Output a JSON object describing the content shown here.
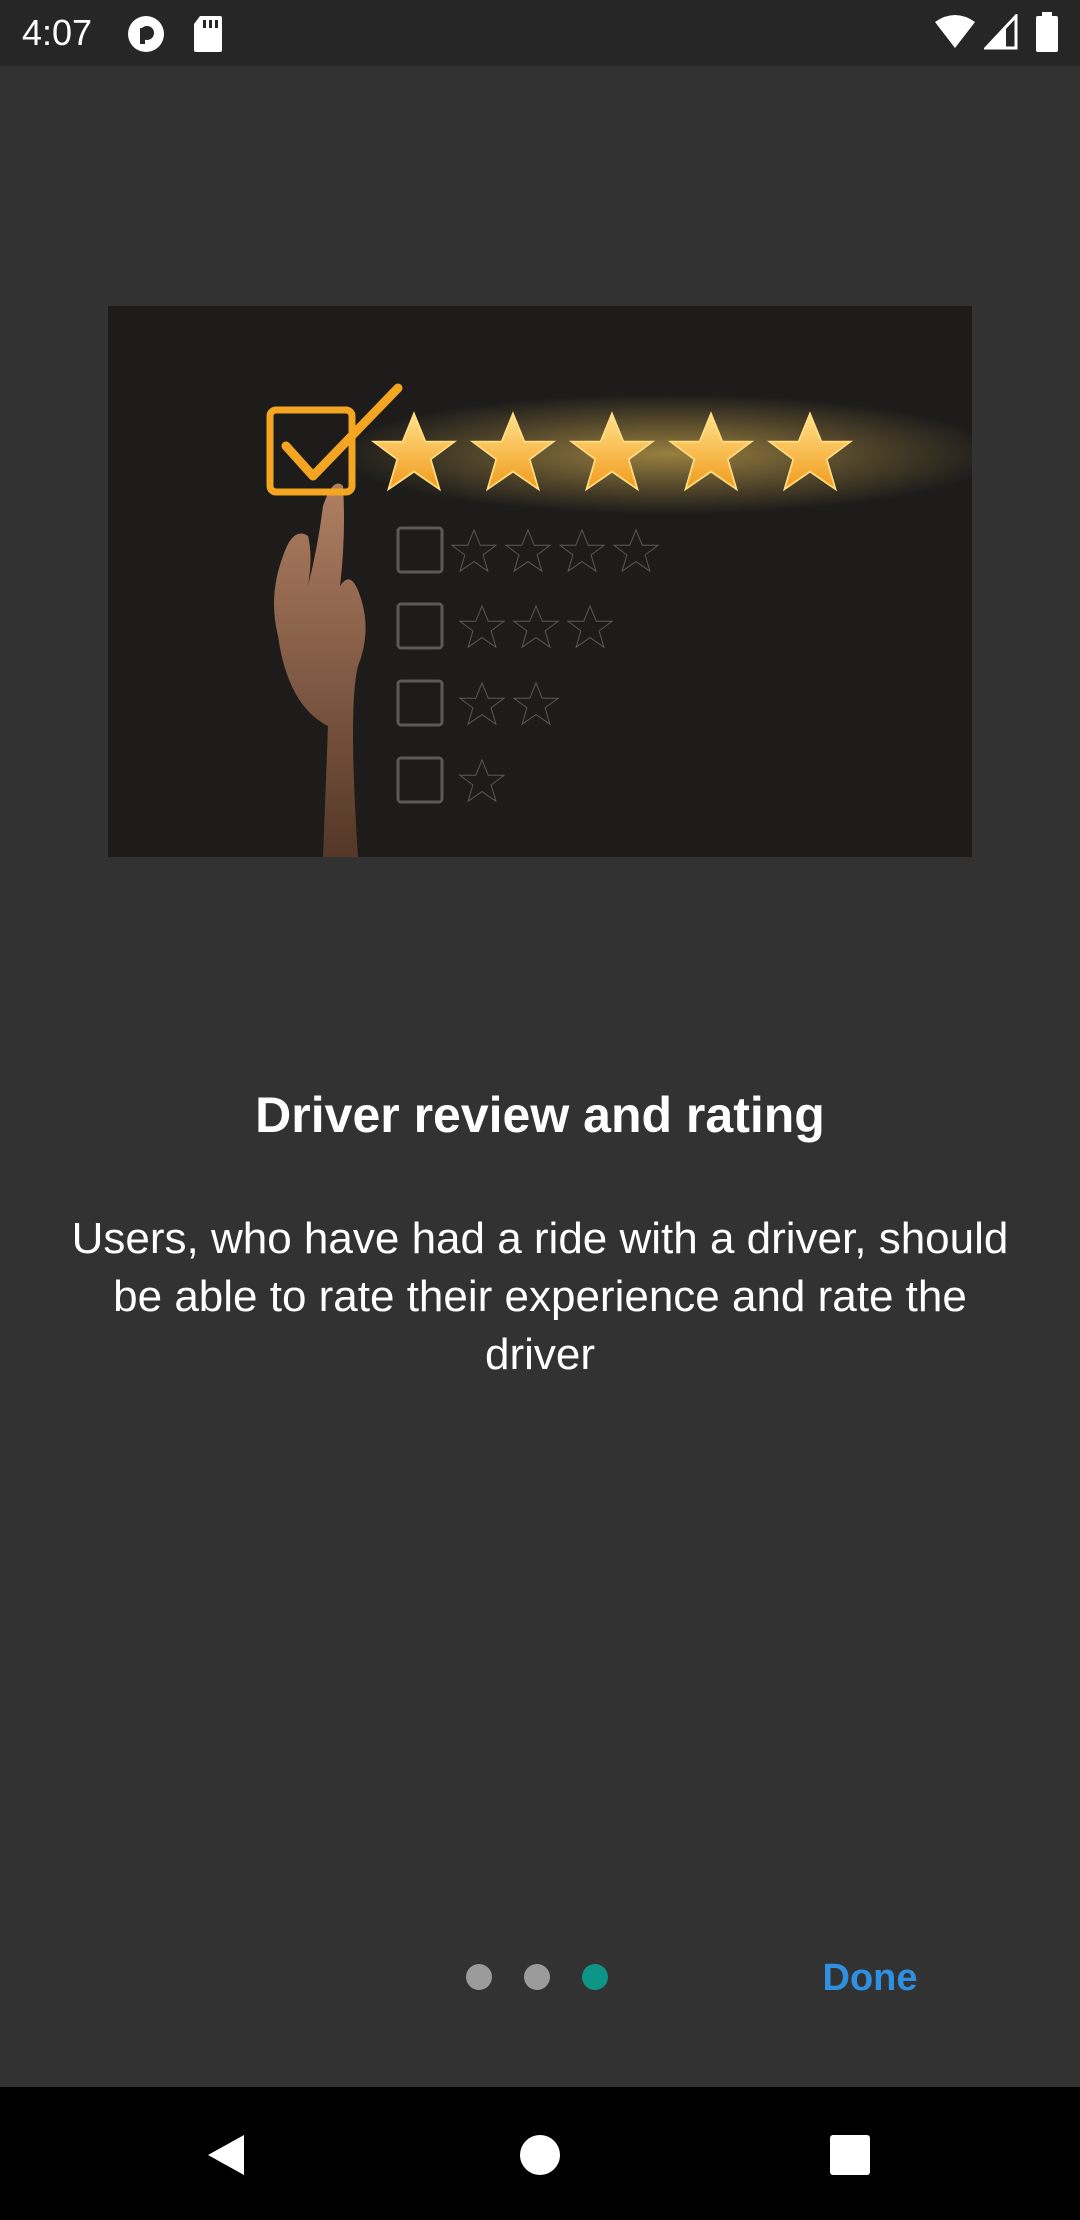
{
  "status_bar": {
    "time": "4:07",
    "icons": [
      "pocketcasts-icon",
      "sd-card-icon",
      "wifi-icon",
      "signal-icon",
      "battery-icon"
    ]
  },
  "onboarding": {
    "image_description_icon": "rating-stars-image",
    "title": "Driver review and rating",
    "description": "Users, who have had a ride with a driver, should be able to rate their experience and rate the driver",
    "page_indicator": {
      "total": 3,
      "current": 3
    },
    "done_label": "Done"
  },
  "nav_bar": {
    "icons": [
      "back-icon",
      "home-icon",
      "recents-icon"
    ]
  },
  "colors": {
    "background": "#323232",
    "accent_dot": "#0f9488",
    "done": "#2f8fe0",
    "star": "#f6b33a"
  }
}
